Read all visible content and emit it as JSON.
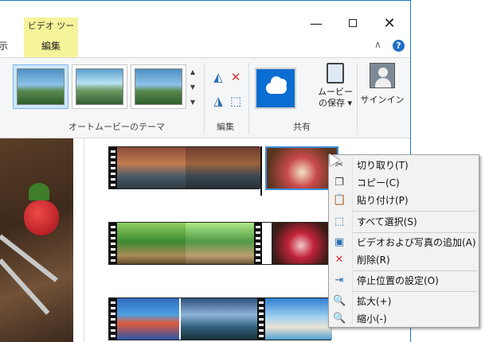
{
  "titlebar": {
    "contextual_tab_header": "ビデオ ツール"
  },
  "tabs": {
    "view": "示",
    "edit": "編集"
  },
  "ribbon": {
    "auto_movie_theme_label": "オートムービーのテーマ",
    "edit_group_label": "編集",
    "share_group_label": "共有",
    "save_movie_line1": "ムービー",
    "save_movie_line2": "の保存 ▾",
    "signin_label": "サインイン"
  },
  "context_menu": {
    "items": [
      {
        "label": "切り取り(T)",
        "icon": "cut-icon"
      },
      {
        "label": "コピー(C)",
        "icon": "copy-icon"
      },
      {
        "label": "貼り付け(P)",
        "icon": "paste-icon"
      },
      {
        "label": "すべて選択(S)",
        "icon": "select-all-icon"
      },
      {
        "label": "ビデオおよび写真の追加(A)",
        "icon": "add-media-icon"
      },
      {
        "label": "削除(R)",
        "icon": "delete-icon"
      },
      {
        "label": "停止位置の設定(O)",
        "icon": "set-end-point-icon"
      },
      {
        "label": "拡大(+)",
        "icon": "zoom-in-icon"
      },
      {
        "label": "縮小(-)",
        "icon": "zoom-out-icon"
      }
    ]
  },
  "colors": {
    "window_border": "#1979ca",
    "contextual_tab": "#f6f49a",
    "share_tile": "#0a6dd1",
    "selection_border": "#3c8fd6",
    "menu_background": "#f2f2f2"
  }
}
